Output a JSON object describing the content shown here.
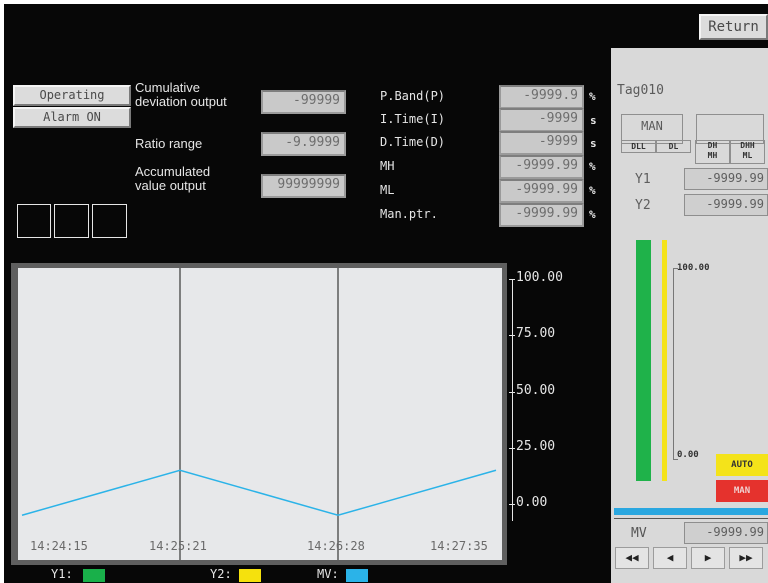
{
  "header": {
    "return_label": "Return"
  },
  "status": {
    "operating_label": "Operating",
    "alarm_label": "Alarm ON"
  },
  "params_left": [
    {
      "label": "Cumulative\ndeviation output",
      "value": "-99999"
    },
    {
      "label": "Ratio range",
      "value": "-9.9999"
    },
    {
      "label": "Accumulated\nvalue output",
      "value": "99999999"
    }
  ],
  "params_right": [
    {
      "label": "P.Band(P)",
      "value": "-9999.9",
      "unit": "%"
    },
    {
      "label": "I.Time(I)",
      "value": "-9999",
      "unit": "s"
    },
    {
      "label": "D.Time(D)",
      "value": "-9999",
      "unit": "s"
    },
    {
      "label": "MH",
      "value": "-9999.99",
      "unit": "%"
    },
    {
      "label": "ML",
      "value": "-9999.99",
      "unit": "%"
    },
    {
      "label": "Man.ptr.",
      "value": "-9999.99",
      "unit": "%"
    }
  ],
  "chart_data": {
    "type": "line",
    "title": "",
    "xlabel": "",
    "ylabel": "",
    "x": [
      "14:24:15",
      "14:25:21",
      "14:26:28",
      "14:27:35"
    ],
    "y_ticks": [
      "100.00",
      "75.00",
      "50.00",
      "25.00",
      "0.00"
    ],
    "ylim": [
      0,
      100
    ],
    "grid": "vertical lines at 14:25:21 and 14:26:28",
    "series": [
      {
        "name": "Y1",
        "color": "#19b04a",
        "values": []
      },
      {
        "name": "Y2",
        "color": "#f5e10d",
        "values": []
      },
      {
        "name": "MV",
        "color": "#2bb3e8",
        "values": [
          -5,
          15,
          -5,
          15
        ]
      }
    ]
  },
  "legend": [
    {
      "label": "Y1:",
      "color": "#19b04a"
    },
    {
      "label": "Y2:",
      "color": "#f5e10d"
    },
    {
      "label": "MV:",
      "color": "#2bb3e8"
    }
  ],
  "faceplate": {
    "tag": "Tag010",
    "mode": "MAN",
    "alarm_cells": [
      "DLL",
      "DL",
      "DH\nMH",
      "DHH\nML"
    ],
    "y1_label": "Y1",
    "y1_value": "-9999.99",
    "y2_label": "Y2",
    "y2_value": "-9999.99",
    "bar_top": "100.00",
    "bar_bottom": "0.00",
    "auto_label": "AUTO",
    "man_label": "MAN",
    "mv_label": "MV",
    "mv_value": "-9999.99",
    "nav": [
      "◀◀",
      "◀",
      "▶",
      "▶▶"
    ],
    "colors": {
      "y1_bar": "#1fb24a",
      "y2_bar": "#f4e31a",
      "auto": "#f4e31a",
      "man": "#e5322d",
      "mv_bar": "#2aa7e0"
    }
  }
}
